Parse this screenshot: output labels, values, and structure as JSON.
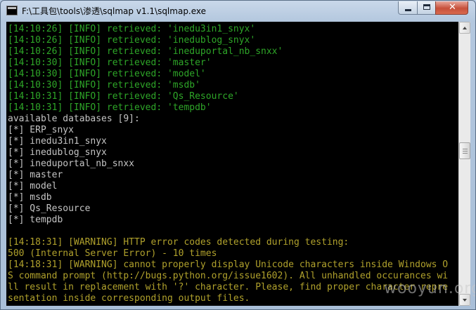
{
  "window": {
    "title": "F:\\工具包\\tools\\渗透\\sqlmap v1.1\\sqlmap.exe",
    "close_glyph": "✕"
  },
  "console": {
    "lines": [
      {
        "text": "[14:10:26] [INFO] retrieved: 'inedu3in1_snyx'",
        "color": "green"
      },
      {
        "text": "[14:10:26] [INFO] retrieved: 'inedublog_snyx'",
        "color": "green"
      },
      {
        "text": "[14:10:26] [INFO] retrieved: 'ineduportal_nb_snxx'",
        "color": "green"
      },
      {
        "text": "[14:10:30] [INFO] retrieved: 'master'",
        "color": "green"
      },
      {
        "text": "[14:10:30] [INFO] retrieved: 'model'",
        "color": "green"
      },
      {
        "text": "[14:10:30] [INFO] retrieved: 'msdb'",
        "color": "green"
      },
      {
        "text": "[14:10:31] [INFO] retrieved: 'Qs_Resource'",
        "color": "green"
      },
      {
        "text": "[14:10:31] [INFO] retrieved: 'tempdb'",
        "color": "green"
      },
      {
        "text": "available databases [9]:",
        "color": "white"
      },
      {
        "text": "[*] ERP_snyx",
        "color": "white"
      },
      {
        "text": "[*] inedu3in1_snyx",
        "color": "white"
      },
      {
        "text": "[*] inedublog_snyx",
        "color": "white"
      },
      {
        "text": "[*] ineduportal_nb_snxx",
        "color": "white"
      },
      {
        "text": "[*] master",
        "color": "white"
      },
      {
        "text": "[*] model",
        "color": "white"
      },
      {
        "text": "[*] msdb",
        "color": "white"
      },
      {
        "text": "[*] Qs_Resource",
        "color": "white"
      },
      {
        "text": "[*] tempdb",
        "color": "white"
      },
      {
        "text": "",
        "color": "white"
      },
      {
        "text": "[14:18:31] [WARNING] HTTP error codes detected during testing:",
        "color": "yellow"
      },
      {
        "text": "500 (Internal Server Error) - 10 times",
        "color": "yellow"
      },
      {
        "text": "[14:18:31] [WARNING] cannot properly display Unicode characters inside Windows O",
        "color": "yellow"
      },
      {
        "text": "S command prompt (http://bugs.python.org/issue1602). All unhandled occurances wi",
        "color": "yellow"
      },
      {
        "text": "ll result in replacement with '?' character. Please, find proper character repre",
        "color": "yellow"
      },
      {
        "text": "sentation inside corresponding output files.",
        "color": "yellow"
      }
    ]
  },
  "watermark": "wooyun.org",
  "colors": {
    "green": "#2ea628",
    "white": "#c4c4c4",
    "yellow": "#b0a12c",
    "background": "#000000"
  }
}
